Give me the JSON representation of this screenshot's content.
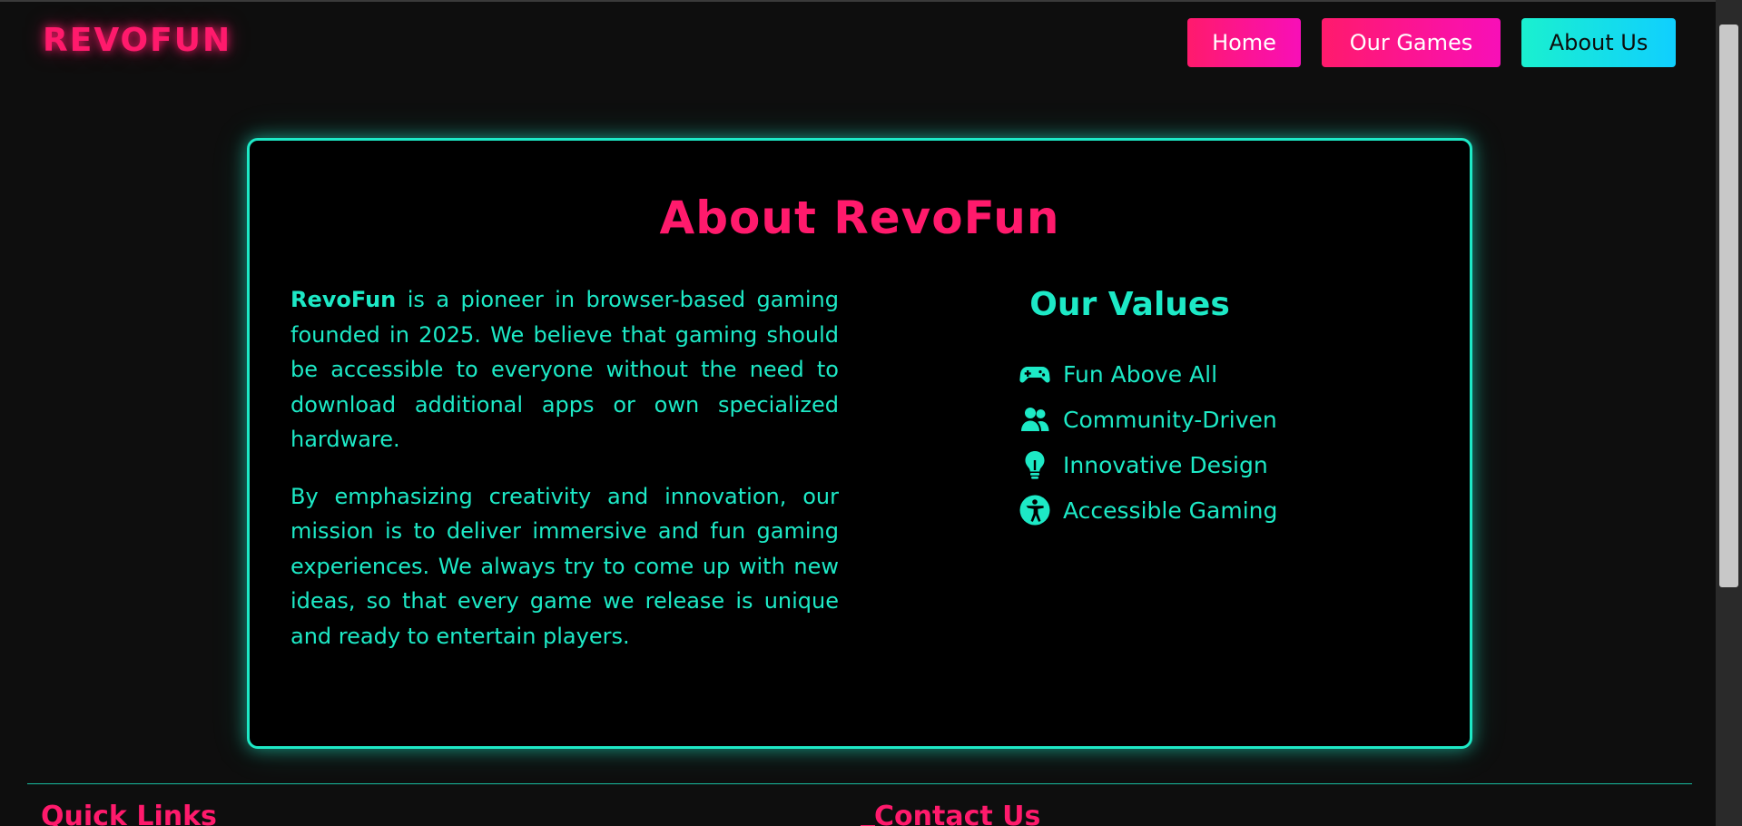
{
  "header": {
    "logo": "REVOFUN",
    "nav": [
      {
        "label": "Home"
      },
      {
        "label": "Our Games"
      },
      {
        "label": "About Us"
      }
    ]
  },
  "about": {
    "title": "About RevoFun",
    "paragraph1_brand": "RevoFun",
    "paragraph1_rest": " is a pioneer in browser-based gaming founded in 2025. We believe that gaming should be accessible to everyone without the need to download additional apps or own specialized hardware.",
    "paragraph2": "By emphasizing creativity and innovation, our mission is to deliver immersive and fun gaming experiences. We always try to come up with new ideas, so that every game we release is unique and ready to entertain players."
  },
  "values": {
    "title": "Our Values",
    "items": [
      {
        "label": "Fun Above All",
        "icon": "gamepad-icon"
      },
      {
        "label": "Community-Driven",
        "icon": "users-icon"
      },
      {
        "label": "Innovative Design",
        "icon": "lightbulb-icon"
      },
      {
        "label": "Accessible Gaming",
        "icon": "accessibility-icon"
      }
    ]
  },
  "footer": {
    "quick_links": "Quick Links",
    "contact": "Contact Us"
  },
  "colors": {
    "accent_pink": "#ff1a6c",
    "accent_cyan": "#1de9c6",
    "background": "#0e0e0e"
  }
}
